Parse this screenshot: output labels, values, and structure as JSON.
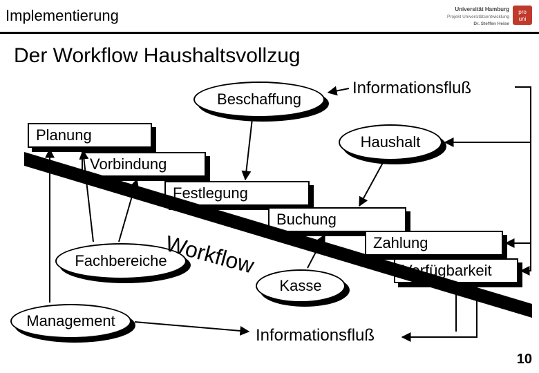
{
  "header": {
    "section": "Implementierung",
    "logo_line1": "Universität Hamburg",
    "logo_line2": "Projekt Universitätsentwicklung",
    "logo_line3": "Dr. Steffen Heise",
    "logo_badge": "pro uni"
  },
  "title": "Der Workflow Haushaltsvollzug",
  "labels": {
    "info_top": "Informationsfluß",
    "info_bottom": "Informationsfluß",
    "workflow": "Workflow"
  },
  "ellipses": {
    "beschaffung": "Beschaffung",
    "haushalt": "Haushalt",
    "fachbereiche": "Fachbereiche",
    "kasse": "Kasse",
    "management": "Management"
  },
  "rects": {
    "planung": "Planung",
    "vorbindung": "Vorbindung",
    "festlegung": "Festlegung",
    "buchung": "Buchung",
    "zahlung": "Zahlung",
    "verfuegbarkeit": "Verfügbarkeit"
  },
  "page_number": "10"
}
